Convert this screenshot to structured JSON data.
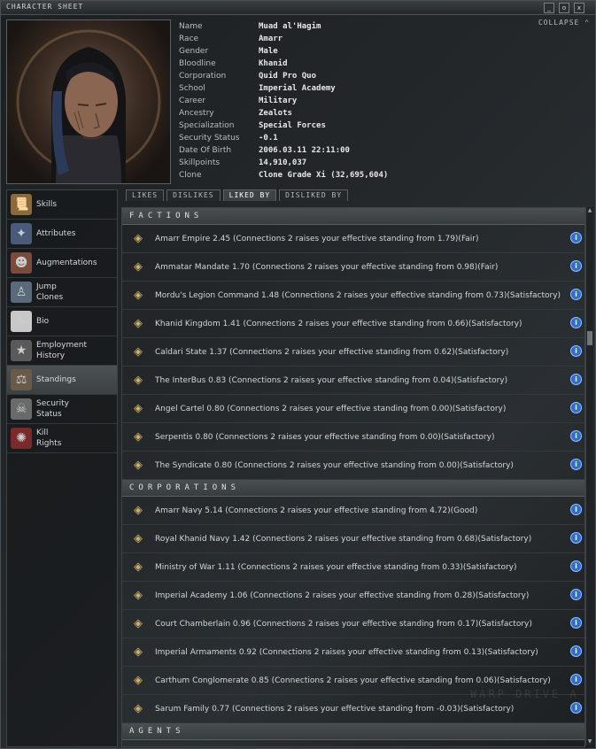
{
  "window": {
    "title": "CHARACTER SHEET",
    "collapse_label": "COLLAPSE"
  },
  "character": {
    "fields": [
      {
        "label": "Name",
        "value": "Muad al'Hagim"
      },
      {
        "label": "Race",
        "value": "Amarr"
      },
      {
        "label": "Gender",
        "value": "Male"
      },
      {
        "label": "Bloodline",
        "value": "Khanid"
      },
      {
        "label": "Corporation",
        "value": "Quid Pro Quo"
      },
      {
        "label": "School",
        "value": "Imperial Academy"
      },
      {
        "label": "Career",
        "value": "Military"
      },
      {
        "label": "Ancestry",
        "value": "Zealots"
      },
      {
        "label": "Specialization",
        "value": "Special Forces"
      },
      {
        "label": "Security Status",
        "value": "-0.1"
      },
      {
        "label": "Date Of Birth",
        "value": "2006.03.11 22:11:00"
      },
      {
        "label": "Skillpoints",
        "value": "14,910,037"
      },
      {
        "label": "Clone",
        "value": "Clone Grade Xi (32,695,604)"
      }
    ]
  },
  "sidebar": {
    "items": [
      {
        "label": "Skills",
        "icon": "skills-icon",
        "active": false
      },
      {
        "label": "Attributes",
        "icon": "attributes-icon",
        "active": false
      },
      {
        "label": "Augmentations",
        "icon": "augmentations-icon",
        "active": false
      },
      {
        "label": "Jump\nClones",
        "icon": "jump-clones-icon",
        "active": false
      },
      {
        "label": "Bio",
        "icon": "bio-icon",
        "active": false
      },
      {
        "label": "Employment\nHistory",
        "icon": "employment-history-icon",
        "active": false
      },
      {
        "label": "Standings",
        "icon": "standings-icon",
        "active": true
      },
      {
        "label": "Security\nStatus",
        "icon": "security-status-icon",
        "active": false
      },
      {
        "label": "Kill\nRights",
        "icon": "kill-rights-icon",
        "active": false
      }
    ]
  },
  "tabs": [
    {
      "label": "LIKES",
      "active": false
    },
    {
      "label": "DISLIKES",
      "active": false
    },
    {
      "label": "LIKED BY",
      "active": true
    },
    {
      "label": "DISLIKED BY",
      "active": false
    }
  ],
  "standings": {
    "factions_header": "FACTIONS",
    "factions": [
      {
        "text": "Amarr Empire 2.45 (Connections 2 raises your effective standing from 1.79)(Fair)",
        "logo": "amarr-logo-icon"
      },
      {
        "text": "Ammatar Mandate 1.70 (Connections 2 raises your effective standing from 0.98)(Fair)",
        "logo": "ammatar-logo-icon"
      },
      {
        "text": "Mordu's Legion Command 1.48 (Connections 2 raises your effective standing from 0.73)(Satisfactory)",
        "logo": "mordus-legion-logo-icon"
      },
      {
        "text": "Khanid Kingdom 1.41 (Connections 2 raises your effective standing from 0.66)(Satisfactory)",
        "logo": "khanid-logo-icon"
      },
      {
        "text": "Caldari State 1.37 (Connections 2 raises your effective standing from 0.62)(Satisfactory)",
        "logo": "caldari-logo-icon"
      },
      {
        "text": "The InterBus 0.83 (Connections 2 raises your effective standing from 0.04)(Satisfactory)",
        "logo": "interbus-logo-icon"
      },
      {
        "text": "Angel Cartel 0.80 (Connections 2 raises your effective standing from 0.00)(Satisfactory)",
        "logo": "angel-cartel-logo-icon"
      },
      {
        "text": "Serpentis 0.80 (Connections 2 raises your effective standing from 0.00)(Satisfactory)",
        "logo": "serpentis-logo-icon"
      },
      {
        "text": "The Syndicate 0.80 (Connections 2 raises your effective standing from 0.00)(Satisfactory)",
        "logo": "syndicate-logo-icon"
      }
    ],
    "corporations_header": "CORPORATIONS",
    "corporations": [
      {
        "text": "Amarr Navy 5.14 (Connections 2 raises your effective standing from 4.72)(Good)",
        "logo": "amarr-navy-logo-icon"
      },
      {
        "text": "Royal Khanid Navy 1.42 (Connections 2 raises your effective standing from 0.68)(Satisfactory)",
        "logo": "royal-khanid-navy-logo-icon"
      },
      {
        "text": "Ministry of War 1.11 (Connections 2 raises your effective standing from 0.33)(Satisfactory)",
        "logo": "ministry-of-war-logo-icon"
      },
      {
        "text": "Imperial Academy 1.06 (Connections 2 raises your effective standing from 0.28)(Satisfactory)",
        "logo": "imperial-academy-logo-icon"
      },
      {
        "text": "Court Chamberlain 0.96 (Connections 2 raises your effective standing from 0.17)(Satisfactory)",
        "logo": "court-chamberlain-logo-icon"
      },
      {
        "text": "Imperial Armaments 0.92 (Connections 2 raises your effective standing from 0.13)(Satisfactory)",
        "logo": "imperial-armaments-logo-icon"
      },
      {
        "text": "Carthum Conglomerate 0.85 (Connections 2 raises your effective standing from 0.06)(Satisfactory)",
        "logo": "carthum-logo-icon"
      },
      {
        "text": "Sarum Family 0.77 (Connections 2 raises your effective standing from -0.03)(Satisfactory)",
        "logo": "sarum-logo-icon"
      }
    ],
    "agents_header": "AGENTS"
  },
  "watermark": "WARP DRIVE A",
  "colors": {
    "accent_info": "#2c6fd0",
    "panel_bg": "#23272a"
  }
}
